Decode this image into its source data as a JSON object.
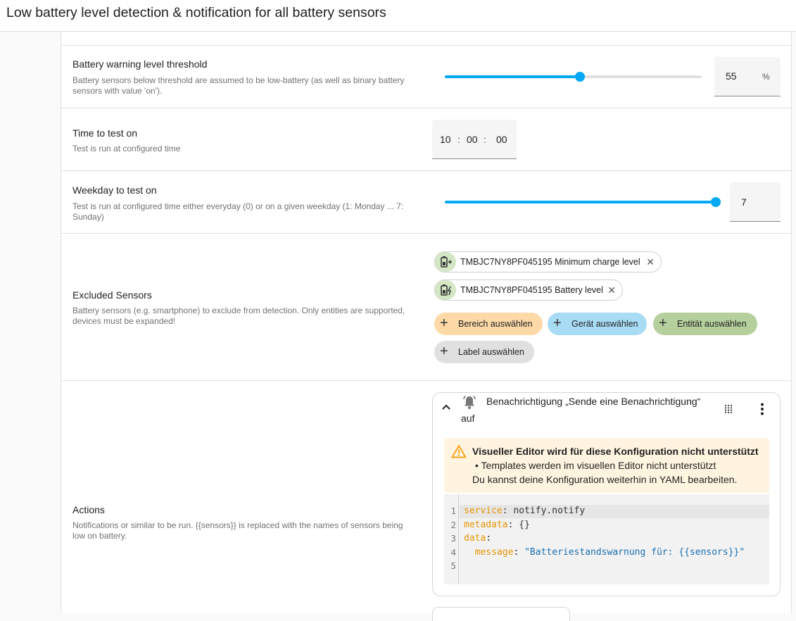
{
  "header": {
    "title": "Low battery level detection & notification for all battery sensors"
  },
  "threshold": {
    "title": "Battery warning level threshold",
    "description": "Battery sensors below threshold are assumed to be low-battery (as well as binary battery sensors with value 'on').",
    "value": "55",
    "unit": "%",
    "slider_fraction": 0.525
  },
  "time": {
    "title": "Time to test on",
    "description": "Test is run at configured time",
    "hours": "10",
    "minutes": "00",
    "seconds": "00"
  },
  "weekday": {
    "title": "Weekday to test on",
    "description": "Test is run at configured time either everyday (0) or on a given weekday (1: Monday ... 7: Sunday)",
    "value": "7",
    "slider_fraction": 1.0
  },
  "excluded": {
    "title": "Excluded Sensors",
    "description": "Battery sensors (e.g. smartphone) to exclude from detection. Only entities are supported, devices must be expanded!",
    "chips": [
      {
        "label": "TMBJC7NY8PF045195 Minimum charge level",
        "icon": "battery-plus-icon"
      },
      {
        "label": "TMBJC7NY8PF045195 Battery level",
        "icon": "battery-charging-icon"
      }
    ],
    "pickers": [
      {
        "label": "Bereich auswählen",
        "color": "#fdd9a8"
      },
      {
        "label": "Gerät auswählen",
        "color": "#a8dcf5"
      },
      {
        "label": "Entität auswählen",
        "color": "#b5cf9d"
      },
      {
        "label": "Label auswählen",
        "color": "#e0e0e0"
      }
    ]
  },
  "actions": {
    "title": "Actions",
    "description": "Notifications or similar to be run. {{sensors}} is replaced with the names of sensors being low on battery.",
    "card": {
      "heading": "Benachrichtigung „Sende eine Benachrichtigung“",
      "heading_suffix": "auf",
      "warning_title": "Visueller Editor wird für diese Konfiguration nicht unterstützt",
      "warning_bullet": "Templates werden im visuellen Editor nicht unterstützt",
      "warning_footer": "Du kannst deine Konfiguration weiterhin in YAML bearbeiten.",
      "code_lines": [
        {
          "n": "1",
          "key": "service",
          "sep": ": ",
          "val": "notify.notify",
          "valclass": ""
        },
        {
          "n": "2",
          "key": "metadata",
          "sep": ": ",
          "val": "{}",
          "valclass": ""
        },
        {
          "n": "3",
          "key": "data",
          "sep": ":",
          "val": "",
          "valclass": ""
        },
        {
          "n": "4",
          "key": "  message",
          "sep": ": ",
          "val": "\"Batteriestandswarnung für: {{sensors}}\"",
          "valclass": "str"
        },
        {
          "n": "5",
          "key": "",
          "sep": "",
          "val": "",
          "valclass": ""
        }
      ]
    }
  },
  "colors": {
    "accent": "#03a9f4",
    "warning": "#f5a623"
  }
}
